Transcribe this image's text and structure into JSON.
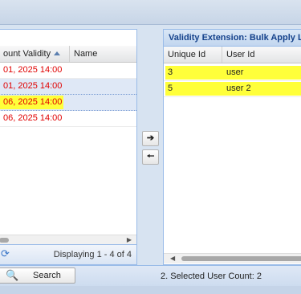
{
  "left_panel": {
    "columns": [
      {
        "label": "ount Validity",
        "sorted": "asc"
      },
      {
        "label": "Name"
      }
    ],
    "rows": [
      {
        "date": "01, 2025 14:00",
        "name": ""
      },
      {
        "date": "01, 2025 14:00",
        "name": ""
      },
      {
        "date": "06, 2025 14:00",
        "name": ""
      },
      {
        "date": "06, 2025 14:00",
        "name": ""
      }
    ],
    "pager_text": "Displaying 1 - 4 of 4"
  },
  "right_panel": {
    "title": "Validity Extension: Bulk Apply List",
    "columns": [
      {
        "label": "Unique Id"
      },
      {
        "label": "User Id"
      }
    ],
    "rows": [
      {
        "unique_id": "3",
        "user_id": "user"
      },
      {
        "unique_id": "5",
        "user_id": "user 2"
      }
    ]
  },
  "transfer": {
    "move_right_icon": "arrow-right-icon",
    "move_left_icon": "arrow-left-icon"
  },
  "bottom": {
    "search_label": "Search",
    "selected_count_label": "2. Selected User Count:",
    "selected_count": "2"
  },
  "colors": {
    "highlight": "#ffff3a",
    "date_text": "#e00000",
    "panel_header_text": "#15428b",
    "panel_border": "#99bbe8"
  }
}
